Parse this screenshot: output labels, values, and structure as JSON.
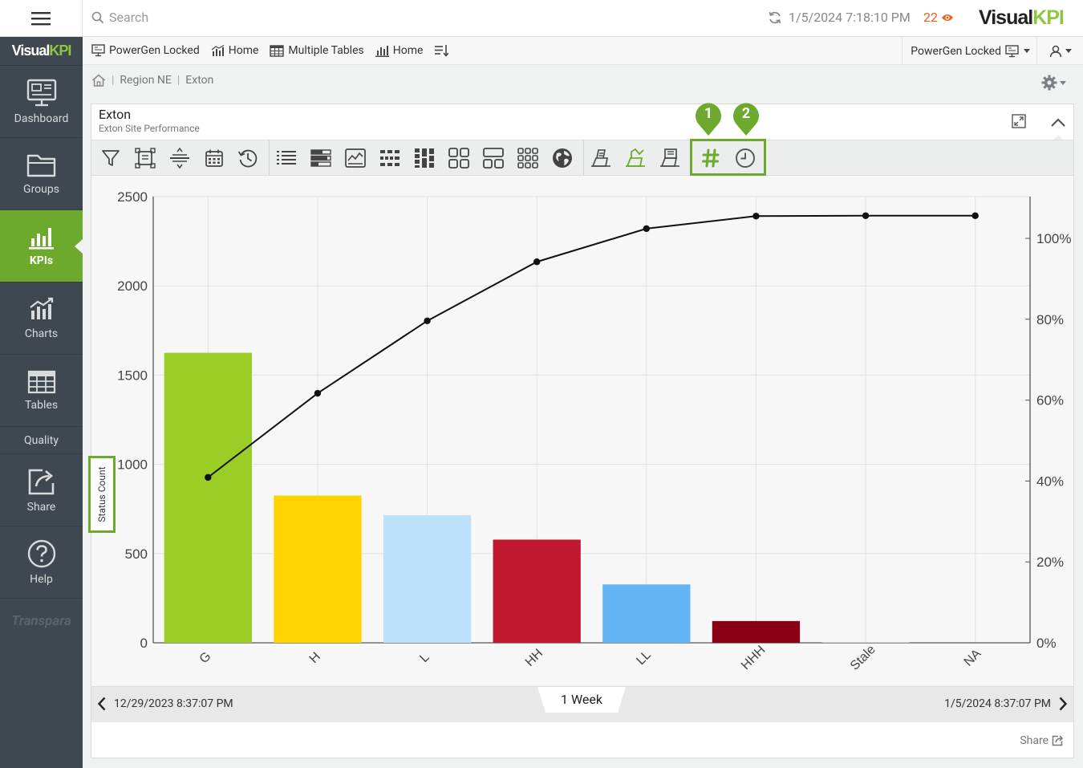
{
  "top": {
    "search_placeholder": "Search",
    "timestamp": "1/5/2024 7:18:10 PM",
    "alert_count": "22",
    "brand_visual": "Visual",
    "brand_kpi": "KPI"
  },
  "sidebar": {
    "logo_visual": "Visual",
    "logo_kpi": "KPI",
    "items": [
      {
        "label": "Dashboard",
        "icon": "dashboard-icon"
      },
      {
        "label": "Groups",
        "icon": "folder-icon"
      },
      {
        "label": "KPIs",
        "icon": "kpi-bars-icon"
      },
      {
        "label": "Charts",
        "icon": "charts-icon"
      },
      {
        "label": "Tables",
        "icon": "table-icon"
      },
      {
        "label": "Quality",
        "icon": ""
      },
      {
        "label": "Share",
        "icon": "share-icon"
      },
      {
        "label": "Help",
        "icon": "help-icon"
      }
    ],
    "footer_brand": "Transpara"
  },
  "nav": {
    "links": [
      {
        "label": "PowerGen Locked",
        "icon": "dashboard-icon"
      },
      {
        "label": "Home",
        "icon": "chart-icon"
      },
      {
        "label": "Multiple Tables",
        "icon": "table-icon"
      },
      {
        "label": "Home",
        "icon": "bar-icon"
      }
    ],
    "right_label": "PowerGen Locked"
  },
  "breadcrumb": {
    "items": [
      "Region NE",
      "Exton"
    ]
  },
  "panel": {
    "title": "Exton",
    "subtitle": "Exton Site Performance"
  },
  "markers": [
    "1",
    "2"
  ],
  "colors": {
    "accent": "#6da92c",
    "sidebar_bg": "#3f4850",
    "alert": "#e8611a"
  },
  "chart_data": {
    "type": "bar",
    "categories": [
      "G",
      "H",
      "L",
      "HH",
      "LL",
      "HHH",
      "Stale",
      "NA"
    ],
    "values": [
      1625,
      825,
      715,
      578,
      327,
      122,
      3,
      0
    ],
    "bar_colors": [
      "#9acd25",
      "#ffd400",
      "#bde0fb",
      "#c0182e",
      "#62b4f5",
      "#8b0012",
      "#cccccc",
      "#cccccc"
    ],
    "cumulative_pct": [
      40.9,
      61.7,
      79.6,
      94.2,
      102.4,
      105.5,
      105.6,
      105.6
    ],
    "ylabel": "Status Count",
    "ylim": [
      0,
      2500
    ],
    "y_ticks": [
      0,
      500,
      1000,
      1500,
      2000,
      2500
    ],
    "y2_ticks": [
      "0%",
      "20%",
      "40%",
      "60%",
      "80%",
      "100%"
    ],
    "y2lim": [
      0,
      100
    ],
    "grid": true
  },
  "timebar": {
    "start": "12/29/2023 8:37:07 PM",
    "end": "1/5/2024 8:37:07 PM",
    "period": "1 Week"
  },
  "share_label": "Share"
}
